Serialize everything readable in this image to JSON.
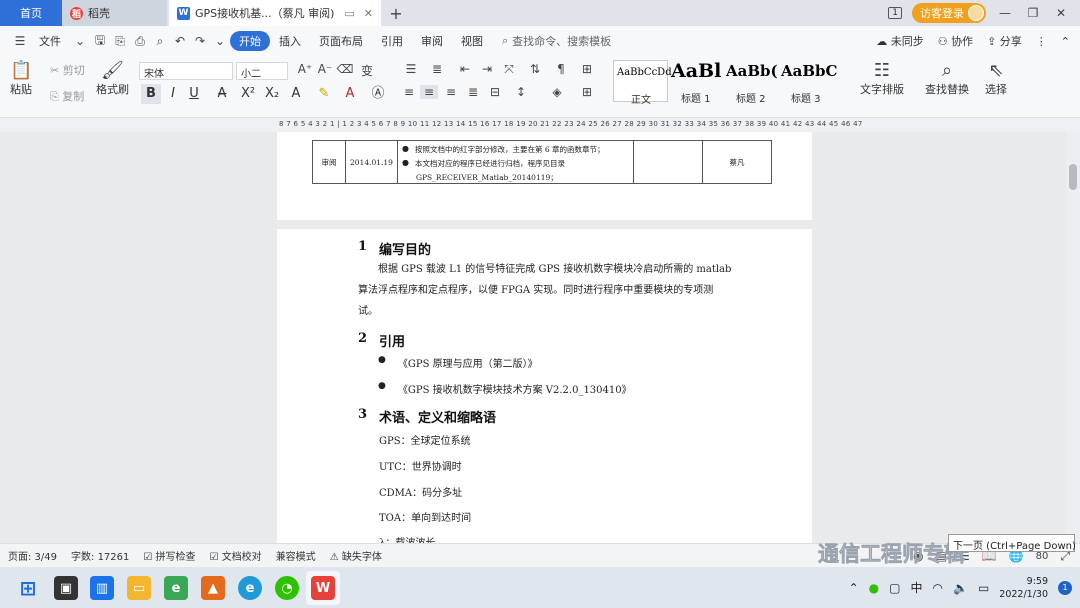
{
  "tabs": {
    "home": "首页",
    "daoke": "稻壳",
    "doc_title": "GPS接收机基...（蔡凡 审阅)",
    "new_tab": "+"
  },
  "titlebar": {
    "badge": "1",
    "login": "访客登录"
  },
  "menu": {
    "file": "文件",
    "items": [
      "开始",
      "插入",
      "页面布局",
      "引用",
      "审阅",
      "视图"
    ],
    "search_placeholder": "查找命令、搜索模板",
    "unsync": "未同步",
    "collab": "协作",
    "share": "分享"
  },
  "ribbon": {
    "paste": "粘贴",
    "cut": "剪切",
    "copy": "复制",
    "format_painter": "格式刷",
    "font": "宋体",
    "size": "小二",
    "styles": [
      {
        "sample": "AaBbCcDd",
        "label": "正文"
      },
      {
        "sample": "AaBl",
        "label": "标题 1"
      },
      {
        "sample": "AaBb(",
        "label": "标题 2"
      },
      {
        "sample": "AaBbC",
        "label": "标题 3"
      }
    ],
    "text_layout": "文字排版",
    "find_replace": "查找替换",
    "select": "选择"
  },
  "ruler": {
    "text": "8 7 6 5 4 3 2 1 | 1 2 3 4 5 6 7 8 9 10 11 12 13 14 15 16 17 18 19 20 21 22 23 24 25 26 27 28 29 30 31 32 33 34 35 36 37 38 39 40 41 42 43 44 45 46 47"
  },
  "revision_table": {
    "type": "审阅",
    "date": "2014.01.19",
    "notes": [
      "按照文档中的红字部分修改，主要在第 6 章的函数章节；",
      "本文档对应的程序已经进行归档，程序见目录",
      "GPS_RECEIVER_Matlab_20140119；"
    ],
    "reviewer": "蔡凡"
  },
  "document": {
    "s1": {
      "num": "1",
      "title": "编写目的"
    },
    "s1_body": "根据 GPS 载波 L1 的信号特征完成 GPS 接收机数字模块冷启动所需的 matlab 算法浮点程序和定点程序，以便 FPGA 实现。同时进行程序中重要模块的专项测试。",
    "s2": {
      "num": "2",
      "title": "引用"
    },
    "refs": [
      "《GPS 原理与应用（第二版）》",
      "《GPS 接收机数字模块技术方案 V2.2.0_130410》"
    ],
    "s3": {
      "num": "3",
      "title": "术语、定义和缩略语"
    },
    "terms": [
      "GPS：全球定位系统",
      "UTC：世界协调时",
      "CDMA：码分多址",
      "TOA：单向到达时间",
      "λ：载波波长"
    ]
  },
  "status": {
    "page": "页面: 3/49",
    "words": "字数: 17261",
    "spell": "拼写检查",
    "proof": "文档校对",
    "compat": "兼容模式",
    "missing_font": "缺失字体",
    "zoom": "80"
  },
  "tooltip": "下一页 (Ctrl+Page Down)",
  "watermark": "通信工程师专辑",
  "taskbar": {
    "ime": "中",
    "time": "9:59",
    "date": "2022/1/30",
    "notifications": "1"
  }
}
